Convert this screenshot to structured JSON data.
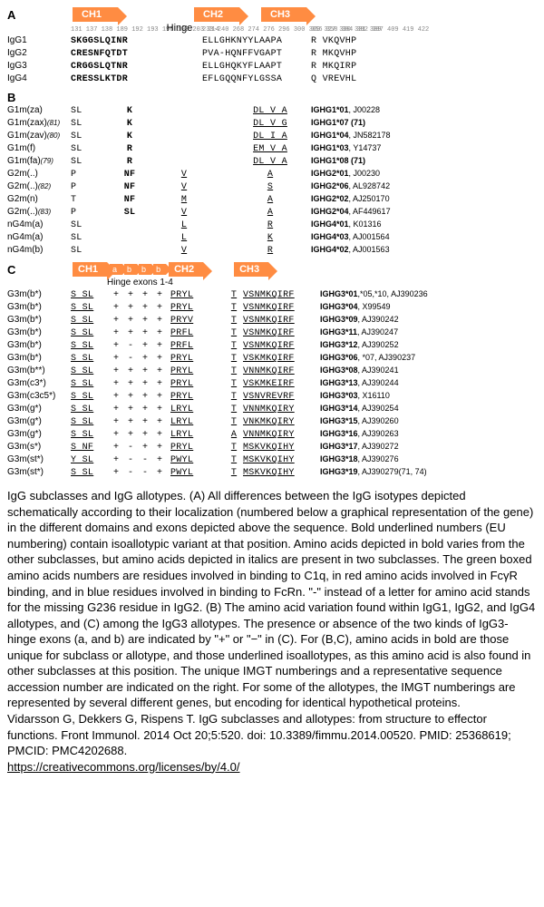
{
  "panelA": {
    "label": "A",
    "domains": [
      "CH1",
      "CH2",
      "CH3"
    ],
    "hingeLabel": "Hinge",
    "rows": [
      {
        "name": "IgG1",
        "ch1": "SKGGSLQINR",
        "ch2": "ELLGHKNYYLAAPA",
        "ch3": "R VKQVHP"
      },
      {
        "name": "IgG2",
        "ch1": "CRESNFQTDT",
        "ch2": "PVA-HQNFFVGAPT",
        "ch3": "R MKQVHP"
      },
      {
        "name": "IgG3",
        "ch1": "CRGGSLQTNR",
        "ch2": "ELLGHQKYFLAAPT",
        "ch3": "R MKQIRP"
      },
      {
        "name": "IgG4",
        "ch1": "CRESSLKTDR",
        "ch2": "EFLGQQNFYLGSSA",
        "ch3": "Q VREVHL"
      }
    ]
  },
  "panelB": {
    "label": "B",
    "rows": [
      {
        "name": "G1m(za)",
        "sup": "",
        "ch1": "SL",
        "h": "K",
        "ch2": "",
        "ch3": "DL V A",
        "acc": "IGHG1*01, J00228"
      },
      {
        "name": "G1m(zax)",
        "sup": "(81)",
        "ch1": "SL",
        "h": "K",
        "ch2": "",
        "ch3": "DL V G",
        "acc": "IGHG1*07 (71)"
      },
      {
        "name": "G1m(zav)",
        "sup": "(80)",
        "ch1": "SL",
        "h": "K",
        "ch2": "",
        "ch3": "DL I A",
        "acc": "IGHG1*04, JN582178"
      },
      {
        "name": "G1m(f)",
        "sup": "",
        "ch1": "SL",
        "h": "R",
        "ch2": "",
        "ch3": "EM V A",
        "acc": "IGHG1*03, Y14737"
      },
      {
        "name": "G1m(fa)",
        "sup": "(79)",
        "ch1": "SL",
        "h": "R",
        "ch2": "",
        "ch3": "DL V A",
        "acc": "IGHG1*08 (71)"
      },
      {
        "name": "G2m(..)",
        "sup": "",
        "ch1": "P",
        "h": "NF",
        "ch2": "V",
        "ch3": "A",
        "acc": "IGHG2*01, J00230"
      },
      {
        "name": "G2m(..)",
        "sup": "(82)",
        "ch1": "P",
        "h": "NF",
        "ch2": "V",
        "ch3": "S",
        "acc": "IGHG2*06, AL928742"
      },
      {
        "name": "G2m(n)",
        "sup": "",
        "ch1": "T",
        "h": "NF",
        "ch2": "M",
        "ch3": "A",
        "acc": "IGHG2*02, AJ250170"
      },
      {
        "name": "G2m(..)",
        "sup": "(83)",
        "ch1": "P",
        "h": "SL",
        "ch2": "V",
        "ch3": "A",
        "acc": "IGHG2*04, AF449617"
      },
      {
        "name": "nG4m(a)",
        "sup": "",
        "ch1": "SL",
        "h": "",
        "ch2": "L",
        "ch3": "R",
        "acc": "IGHG4*01, K01316"
      },
      {
        "name": "nG4m(a)",
        "sup": "",
        "ch1": "SL",
        "h": "",
        "ch2": "L",
        "ch3": "K",
        "acc": "IGHG4*03, AJ001564"
      },
      {
        "name": "nG4m(b)",
        "sup": "",
        "ch1": "SL",
        "h": "",
        "ch2": "V",
        "ch3": "R",
        "acc": "IGHG4*02, AJ001563"
      }
    ]
  },
  "panelC": {
    "label": "C",
    "domains": [
      "CH1",
      "CH2",
      "CH3"
    ],
    "hingeHeader": "Hinge exons 1-4",
    "hingeLetters": [
      "a",
      "b",
      "b",
      "b"
    ],
    "rows": [
      {
        "name": "G3m(b*)",
        "ch1": "S SL",
        "hx": "+ + + +",
        "ch2": "PRYL",
        "ch2b": "T",
        "ch3": "VSNMKQIRF",
        "acc": "IGHG3*01,*05,*10, AJ390236"
      },
      {
        "name": "G3m(b*)",
        "ch1": "S SL",
        "hx": "+ + + +",
        "ch2": "PRYL",
        "ch2b": "T",
        "ch3": "VSNMKQIRF",
        "acc": "IGHG3*04, X99549"
      },
      {
        "name": "G3m(b*)",
        "ch1": "S SL",
        "hx": "+ + + +",
        "ch2": "PRYV",
        "ch2b": "T",
        "ch3": "VSNMKQIRF",
        "acc": "IGHG3*09, AJ390242"
      },
      {
        "name": "G3m(b*)",
        "ch1": "S SL",
        "hx": "+ + + +",
        "ch2": "PRFL",
        "ch2b": "T",
        "ch3": "VSNMKQIRF",
        "acc": "IGHG3*11, AJ390247"
      },
      {
        "name": "G3m(b*)",
        "ch1": "S SL",
        "hx": "+ - + +",
        "ch2": "PRFL",
        "ch2b": "T",
        "ch3": "VSNMKQIRF",
        "acc": "IGHG3*12, AJ390252"
      },
      {
        "name": "G3m(b*)",
        "ch1": "S SL",
        "hx": "+ - + +",
        "ch2": "PRYL",
        "ch2b": "T",
        "ch3": "VSKMKQIRF",
        "acc": "IGHG3*06, *07, AJ390237"
      },
      {
        "name": "G3m(b**)",
        "ch1": "S SL",
        "hx": "+ + + +",
        "ch2": "PRYL",
        "ch2b": "T",
        "ch3": "VNNMKQIRF",
        "acc": "IGHG3*08, AJ390241"
      },
      {
        "name": "G3m(c3*)",
        "ch1": "S SL",
        "hx": "+ + + +",
        "ch2": "PRYL",
        "ch2b": "T",
        "ch3": "VSKMKEIRF",
        "acc": "IGHG3*13, AJ390244"
      },
      {
        "name": "G3m(c3c5*)",
        "ch1": "S SL",
        "hx": "+ + + +",
        "ch2": "PRYL",
        "ch2b": "T",
        "ch3": "VSNVREVRF",
        "acc": "IGHG3*03, X16110"
      },
      {
        "name": "G3m(g*)",
        "ch1": "S SL",
        "hx": "+ + + +",
        "ch2": "LRYL",
        "ch2b": "T",
        "ch3": "VNNMKQIRY",
        "acc": "IGHG3*14, AJ390254"
      },
      {
        "name": "G3m(g*)",
        "ch1": "S SL",
        "hx": "+ + + +",
        "ch2": "LRYL",
        "ch2b": "T",
        "ch3": "VNKMKQIRY",
        "acc": "IGHG3*15, AJ390260"
      },
      {
        "name": "G3m(g*)",
        "ch1": "S SL",
        "hx": "+ + + +",
        "ch2": "LRYL",
        "ch2b": "A",
        "ch3": "VNNMKQIRY",
        "acc": "IGHG3*16, AJ390263"
      },
      {
        "name": "G3m(s*)",
        "ch1": "S NF",
        "hx": "+ - + +",
        "ch2": "PRYL",
        "ch2b": "T",
        "ch3": "MSKVKQIHY",
        "acc": "IGHG3*17, AJ390272"
      },
      {
        "name": "G3m(st*)",
        "ch1": "Y SL",
        "hx": "+ - - +",
        "ch2": "PWYL",
        "ch2b": "T",
        "ch3": "MSKVKQIHY",
        "acc": "IGHG3*18, AJ390276"
      },
      {
        "name": "G3m(st*)",
        "ch1": "S SL",
        "hx": "+ - - +",
        "ch2": "PWYL",
        "ch2b": "T",
        "ch3": "MSKVKQIHY",
        "acc": "IGHG3*19, AJ390279(71, 74)"
      }
    ]
  },
  "caption": {
    "title": "IgG subclasses and IgG allotypes.",
    "pA": "(A) All differences between the IgG isotypes depicted schematically according to their localization (numbered below a graphical representation of the gene) in the different domains and exons depicted above the sequence. Bold underlined numbers (EU numbering) contain isoallotypic variant at that position. Amino acids depicted in bold varies from the other subclasses, but amino acids depicted in italics are present in two subclasses. The green boxed amino acids numbers are residues involved in binding to C1q, in red amino acids involved in FcγR binding, and in blue residues involved in binding to FcRn. \"-\" instead of a letter for amino acid stands for the missing G236 residue in IgG2.",
    "pB": "(B) The amino acid variation found within IgG1, IgG2, and IgG4 allotypes, and",
    "pC": "(C) among the IgG3 allotypes. The presence or absence of the two kinds of IgG3-hinge exons (a, and b) are indicated by \"+\" or \"−\" in (C). For (B,C), amino acids in bold are those unique for subclass or allotype, and those underlined isoallotypes, as this amino acid is also found in other subclasses at this position. The unique IMGT numberings and a representative sequence accession number are indicated on the right. For some of the allotypes, the IMGT numberings are represented by several different genes, but encoding for identical hypothetical proteins.",
    "cite": "Vidarsson G, Dekkers G, Rispens T. IgG subclasses and allotypes: from structure to effector functions. Front Immunol. 2014 Oct 20;5:520. doi: 10.3389/fimmu.2014.00520. PMID: 25368619; PMCID: PMC4202688.",
    "license": "https://creativecommons.org/licenses/by/4.0/"
  }
}
